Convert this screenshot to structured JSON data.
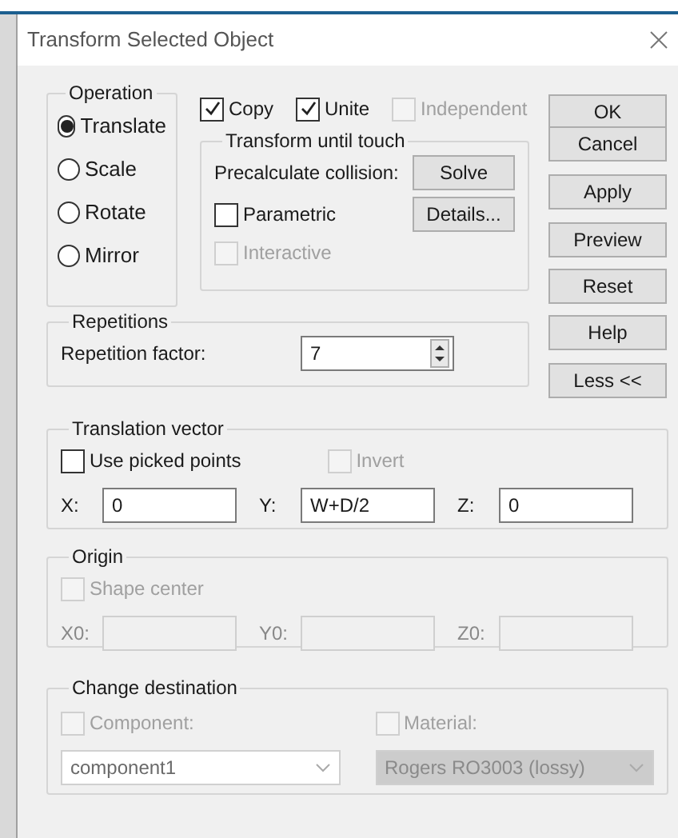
{
  "window": {
    "title": "Transform Selected Object"
  },
  "operation": {
    "label": "Operation",
    "options": [
      {
        "label": "Translate",
        "selected": true
      },
      {
        "label": "Scale",
        "selected": false
      },
      {
        "label": "Rotate",
        "selected": false
      },
      {
        "label": "Mirror",
        "selected": false
      }
    ]
  },
  "options": [
    {
      "label": "Copy",
      "checked": true,
      "disabled": false
    },
    {
      "label": "Unite",
      "checked": true,
      "disabled": false
    },
    {
      "label": "Independent",
      "checked": false,
      "disabled": true
    }
  ],
  "transform_until_touch": {
    "label": "Transform until touch",
    "precalculate_label": "Precalculate collision:",
    "solve_button": "Solve",
    "details_button": "Details...",
    "parametric": {
      "label": "Parametric",
      "checked": false,
      "disabled": false
    },
    "interactive": {
      "label": "Interactive",
      "checked": false,
      "disabled": true
    }
  },
  "repetitions": {
    "label": "Repetitions",
    "factor_label": "Repetition factor:",
    "factor": "7"
  },
  "buttons": [
    "OK",
    "Cancel",
    "Apply",
    "Preview",
    "Reset",
    "Help",
    "Less <<"
  ],
  "translation_vector": {
    "label": "Translation vector",
    "use_picked_points": {
      "label": "Use picked points",
      "checked": false,
      "disabled": false
    },
    "invert": {
      "label": "Invert",
      "checked": false,
      "disabled": true
    },
    "fields": [
      {
        "label": "X:",
        "value": "0",
        "disabled": false
      },
      {
        "label": "Y:",
        "value": "W+D/2",
        "disabled": false
      },
      {
        "label": "Z:",
        "value": "0",
        "disabled": false
      }
    ]
  },
  "origin": {
    "label": "Origin",
    "shape_center": {
      "label": "Shape center",
      "checked": false,
      "disabled": true
    },
    "fields": [
      {
        "label": "X0:",
        "disabled": true
      },
      {
        "label": "Y0:",
        "disabled": true
      },
      {
        "label": "Z0:",
        "disabled": true
      }
    ]
  },
  "change_destination": {
    "label": "Change destination",
    "component": {
      "label": "Component:",
      "checked": false,
      "disabled": true
    },
    "material": {
      "label": "Material:",
      "checked": false,
      "disabled": true
    },
    "component_select": {
      "value": "component1",
      "disabled": false
    },
    "material_select": {
      "value": "Rogers RO3003 (lossy)",
      "disabled": true
    }
  }
}
